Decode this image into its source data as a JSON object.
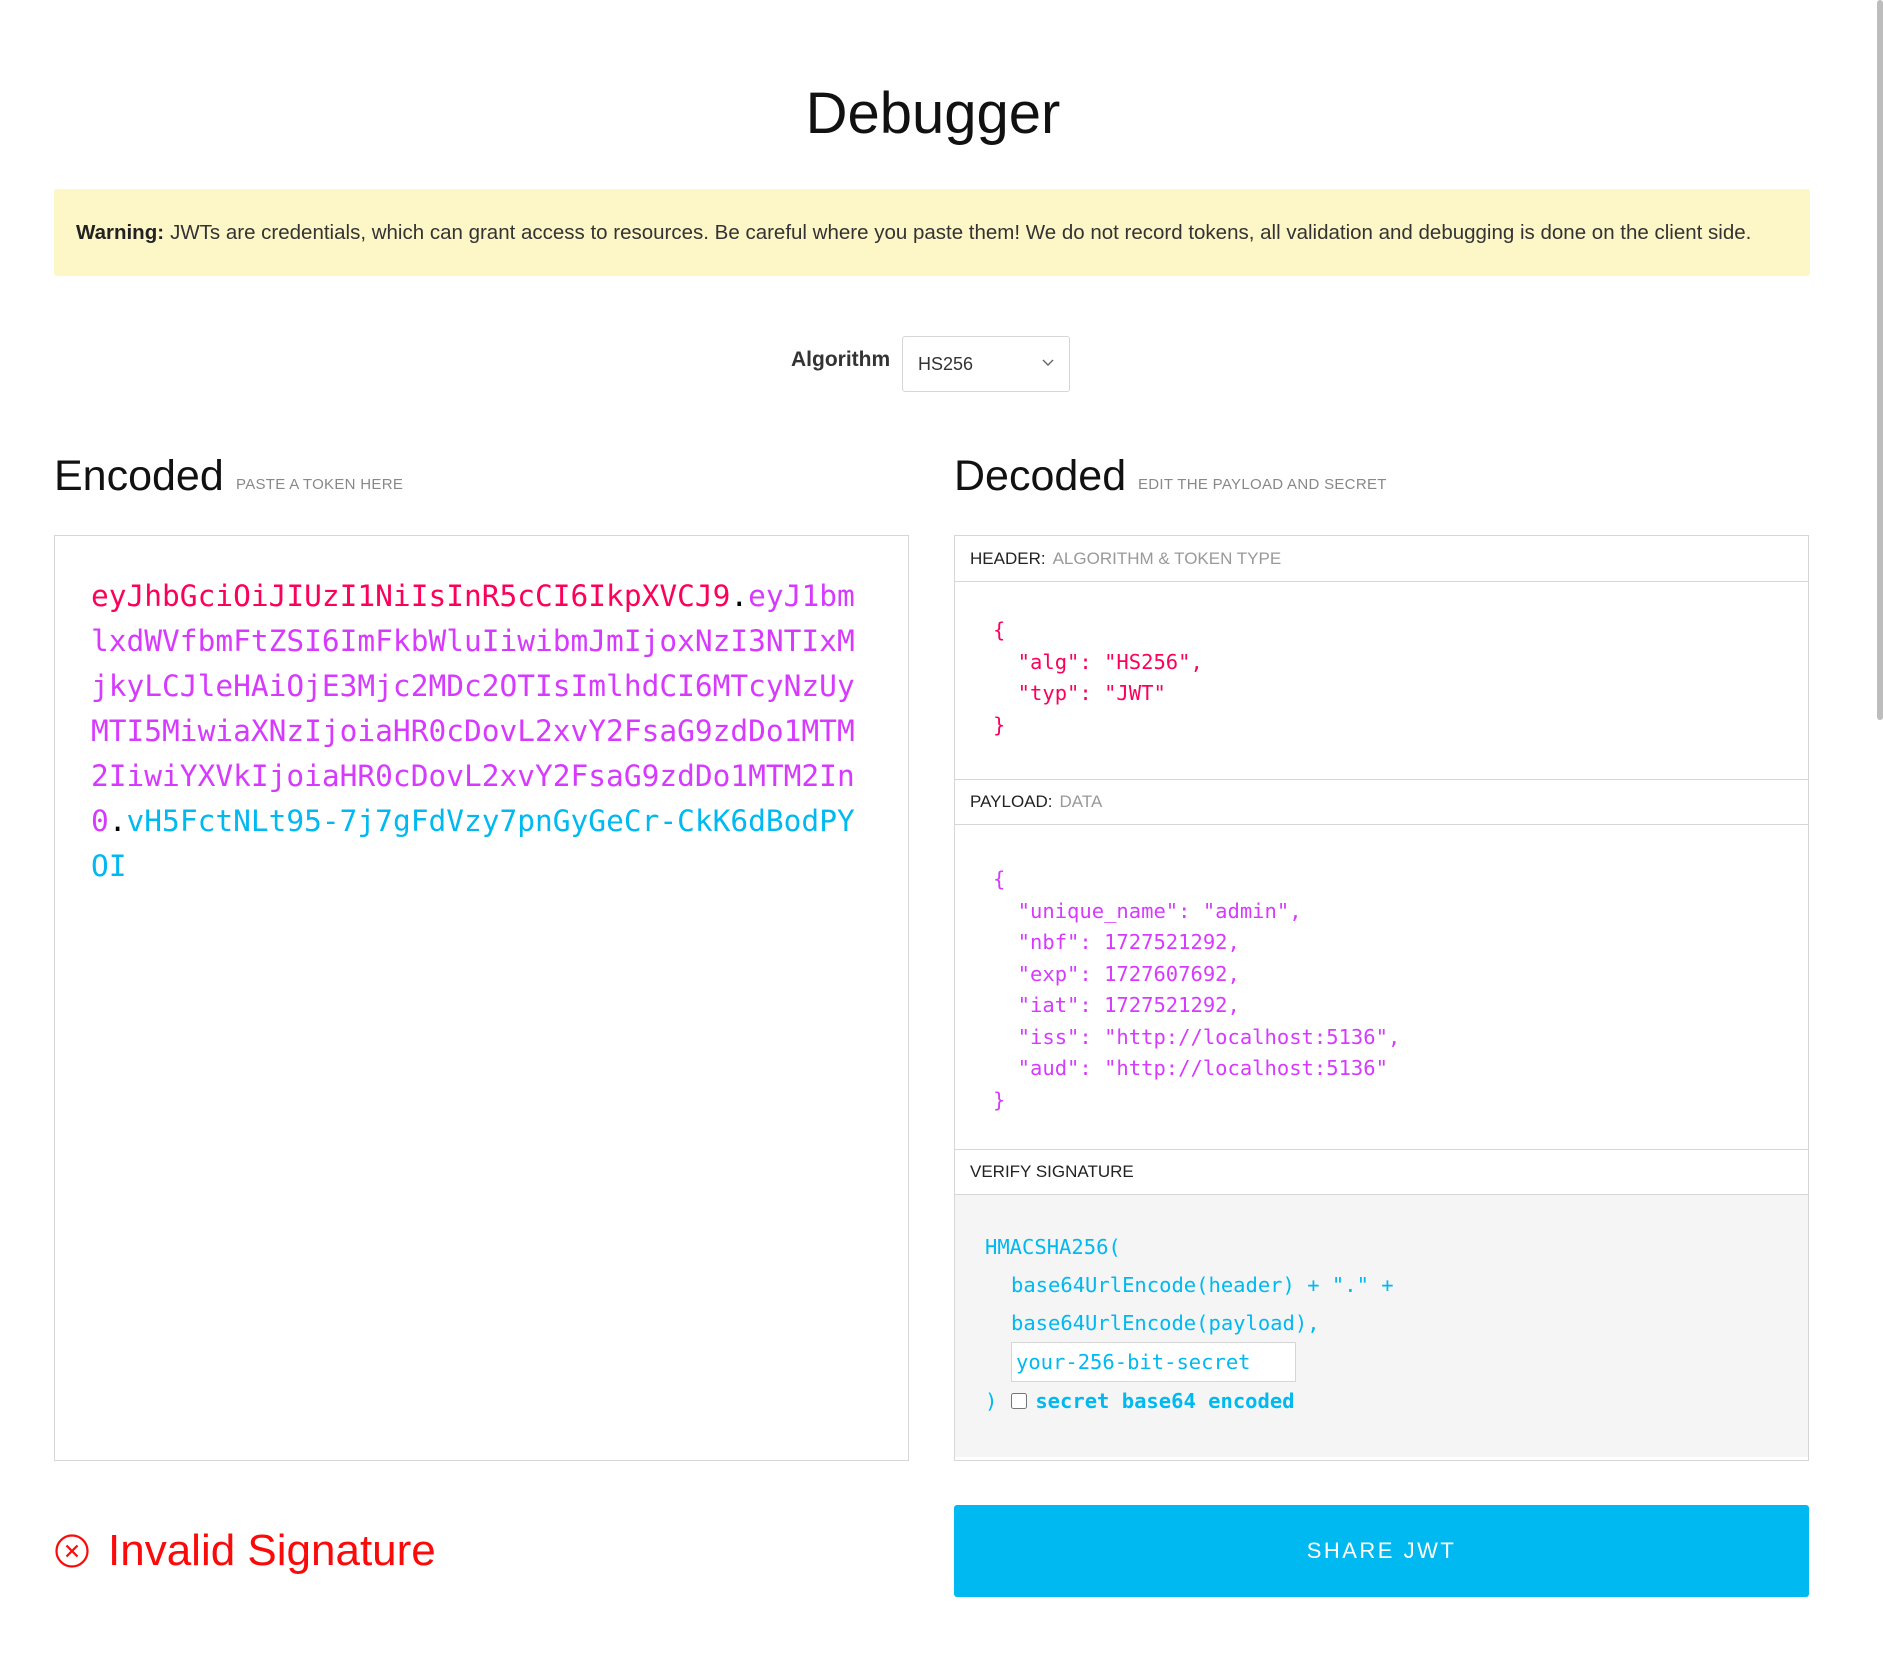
{
  "page": {
    "title": "Debugger"
  },
  "warning": {
    "label": "Warning:",
    "text": "JWTs are credentials, which can grant access to resources. Be careful where you paste them! We do not record tokens, all validation and debugging is done on the client side."
  },
  "algorithm": {
    "label": "Algorithm",
    "selected": "HS256"
  },
  "encoded": {
    "title": "Encoded",
    "hint": "PASTE A TOKEN HERE",
    "token_header": "eyJhbGciOiJIUzI1NiIsInR5cCI6IkpXVCJ9",
    "dot": ".",
    "token_payload": "eyJ1bmlxdWVfbmFtZSI6ImFkbWluIiwibmJmIjoxNzI3NTIxMjkyLCJleHAiOjE3Mjc2MDc2OTIsImlhdCI6MTcyNzUyMTI5MiwiaXNzIjoiaHR0cDovL2xvY2FsaG9zdDo1MTM2IiwiYXVkIjoiaHR0cDovL2xvY2FsaG9zdDo1MTM2In0",
    "token_signature": "vH5FctNLt95-7j7gFdVzy7pnGyGeCr-CkK6dBodPYOI"
  },
  "decoded": {
    "title": "Decoded",
    "hint": "EDIT THE PAYLOAD AND SECRET",
    "header": {
      "label": "HEADER:",
      "sub": "ALGORITHM & TOKEN TYPE",
      "json": "{\n  \"alg\": \"HS256\",\n  \"typ\": \"JWT\"\n}"
    },
    "payload": {
      "label": "PAYLOAD:",
      "sub": "DATA",
      "json": "{\n  \"unique_name\": \"admin\",\n  \"nbf\": 1727521292,\n  \"exp\": 1727607692,\n  \"iat\": 1727521292,\n  \"iss\": \"http://localhost:5136\",\n  \"aud\": \"http://localhost:5136\"\n}"
    },
    "verify": {
      "label": "VERIFY SIGNATURE",
      "fn_open": "HMACSHA256(",
      "line1": "base64UrlEncode(header) + \".\" +",
      "line2": "base64UrlEncode(payload),",
      "secret_placeholder": "your-256-bit-secret",
      "close": ")",
      "b64_label": "secret base64 encoded"
    }
  },
  "status": {
    "text": "Invalid Signature",
    "color": "#fb0a0a"
  },
  "share": {
    "label": "SHARE JWT"
  },
  "colors": {
    "header": "#fb015b",
    "payload": "#d63aff",
    "signature": "#00b9f1",
    "warning_bg": "#fdf6c7"
  }
}
